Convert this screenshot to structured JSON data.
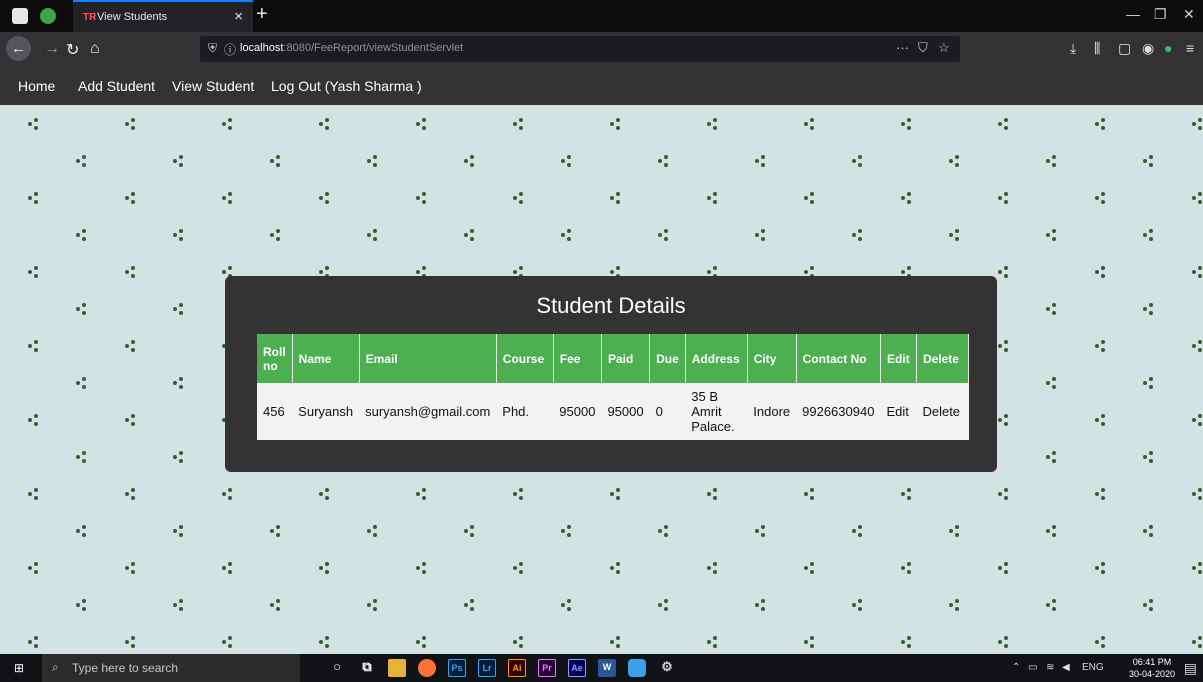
{
  "browser": {
    "tab_title": "View Students",
    "tab_favicon": "TR",
    "url_host": "localhost",
    "url_rest": ":8080/FeeReport/viewStudentServlet",
    "url_more": "···"
  },
  "nav": {
    "items": [
      "Home",
      "Add Student",
      "View Student",
      "Log Out (Yash Sharma )"
    ]
  },
  "panel": {
    "title": "Student Details",
    "columns": [
      "Roll no",
      "Name",
      "Email",
      "Course",
      "Fee",
      "Paid",
      "Due",
      "Address",
      "City",
      "Contact No",
      "Edit",
      "Delete"
    ],
    "rows": [
      [
        "456",
        "Suryansh",
        "suryansh@gmail.com",
        "Phd.",
        "95000",
        "95000",
        "0",
        "35 B Amrit Palace.",
        "Indore",
        "9926630940",
        "Edit",
        "Delete"
      ]
    ]
  },
  "taskbar": {
    "search_placeholder": "Type here to search",
    "apps": [
      "Ps",
      "Lr",
      "Ai",
      "Pr",
      "Ae",
      "W"
    ],
    "language": "ENG",
    "time": "06:41 PM",
    "date": "30-04-2020"
  },
  "colors": {
    "header_green": "#4caf50",
    "panel_bg": "#333333",
    "page_bg": "#d3e2e2",
    "tab_accent": "#0a84ff"
  }
}
